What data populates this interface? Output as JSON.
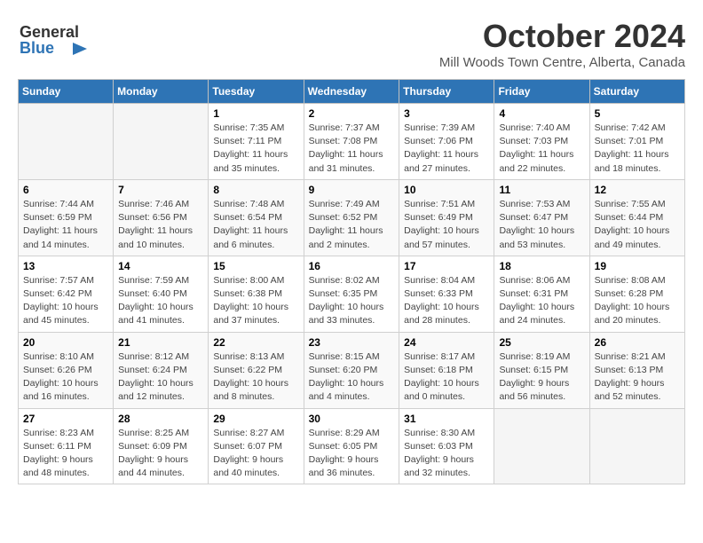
{
  "header": {
    "logo_line1": "General",
    "logo_line2": "Blue",
    "title": "October 2024",
    "subtitle": "Mill Woods Town Centre, Alberta, Canada"
  },
  "calendar": {
    "days_of_week": [
      "Sunday",
      "Monday",
      "Tuesday",
      "Wednesday",
      "Thursday",
      "Friday",
      "Saturday"
    ],
    "weeks": [
      [
        {
          "day": "",
          "detail": ""
        },
        {
          "day": "",
          "detail": ""
        },
        {
          "day": "1",
          "detail": "Sunrise: 7:35 AM\nSunset: 7:11 PM\nDaylight: 11 hours and 35 minutes."
        },
        {
          "day": "2",
          "detail": "Sunrise: 7:37 AM\nSunset: 7:08 PM\nDaylight: 11 hours and 31 minutes."
        },
        {
          "day": "3",
          "detail": "Sunrise: 7:39 AM\nSunset: 7:06 PM\nDaylight: 11 hours and 27 minutes."
        },
        {
          "day": "4",
          "detail": "Sunrise: 7:40 AM\nSunset: 7:03 PM\nDaylight: 11 hours and 22 minutes."
        },
        {
          "day": "5",
          "detail": "Sunrise: 7:42 AM\nSunset: 7:01 PM\nDaylight: 11 hours and 18 minutes."
        }
      ],
      [
        {
          "day": "6",
          "detail": "Sunrise: 7:44 AM\nSunset: 6:59 PM\nDaylight: 11 hours and 14 minutes."
        },
        {
          "day": "7",
          "detail": "Sunrise: 7:46 AM\nSunset: 6:56 PM\nDaylight: 11 hours and 10 minutes."
        },
        {
          "day": "8",
          "detail": "Sunrise: 7:48 AM\nSunset: 6:54 PM\nDaylight: 11 hours and 6 minutes."
        },
        {
          "day": "9",
          "detail": "Sunrise: 7:49 AM\nSunset: 6:52 PM\nDaylight: 11 hours and 2 minutes."
        },
        {
          "day": "10",
          "detail": "Sunrise: 7:51 AM\nSunset: 6:49 PM\nDaylight: 10 hours and 57 minutes."
        },
        {
          "day": "11",
          "detail": "Sunrise: 7:53 AM\nSunset: 6:47 PM\nDaylight: 10 hours and 53 minutes."
        },
        {
          "day": "12",
          "detail": "Sunrise: 7:55 AM\nSunset: 6:44 PM\nDaylight: 10 hours and 49 minutes."
        }
      ],
      [
        {
          "day": "13",
          "detail": "Sunrise: 7:57 AM\nSunset: 6:42 PM\nDaylight: 10 hours and 45 minutes."
        },
        {
          "day": "14",
          "detail": "Sunrise: 7:59 AM\nSunset: 6:40 PM\nDaylight: 10 hours and 41 minutes."
        },
        {
          "day": "15",
          "detail": "Sunrise: 8:00 AM\nSunset: 6:38 PM\nDaylight: 10 hours and 37 minutes."
        },
        {
          "day": "16",
          "detail": "Sunrise: 8:02 AM\nSunset: 6:35 PM\nDaylight: 10 hours and 33 minutes."
        },
        {
          "day": "17",
          "detail": "Sunrise: 8:04 AM\nSunset: 6:33 PM\nDaylight: 10 hours and 28 minutes."
        },
        {
          "day": "18",
          "detail": "Sunrise: 8:06 AM\nSunset: 6:31 PM\nDaylight: 10 hours and 24 minutes."
        },
        {
          "day": "19",
          "detail": "Sunrise: 8:08 AM\nSunset: 6:28 PM\nDaylight: 10 hours and 20 minutes."
        }
      ],
      [
        {
          "day": "20",
          "detail": "Sunrise: 8:10 AM\nSunset: 6:26 PM\nDaylight: 10 hours and 16 minutes."
        },
        {
          "day": "21",
          "detail": "Sunrise: 8:12 AM\nSunset: 6:24 PM\nDaylight: 10 hours and 12 minutes."
        },
        {
          "day": "22",
          "detail": "Sunrise: 8:13 AM\nSunset: 6:22 PM\nDaylight: 10 hours and 8 minutes."
        },
        {
          "day": "23",
          "detail": "Sunrise: 8:15 AM\nSunset: 6:20 PM\nDaylight: 10 hours and 4 minutes."
        },
        {
          "day": "24",
          "detail": "Sunrise: 8:17 AM\nSunset: 6:18 PM\nDaylight: 10 hours and 0 minutes."
        },
        {
          "day": "25",
          "detail": "Sunrise: 8:19 AM\nSunset: 6:15 PM\nDaylight: 9 hours and 56 minutes."
        },
        {
          "day": "26",
          "detail": "Sunrise: 8:21 AM\nSunset: 6:13 PM\nDaylight: 9 hours and 52 minutes."
        }
      ],
      [
        {
          "day": "27",
          "detail": "Sunrise: 8:23 AM\nSunset: 6:11 PM\nDaylight: 9 hours and 48 minutes."
        },
        {
          "day": "28",
          "detail": "Sunrise: 8:25 AM\nSunset: 6:09 PM\nDaylight: 9 hours and 44 minutes."
        },
        {
          "day": "29",
          "detail": "Sunrise: 8:27 AM\nSunset: 6:07 PM\nDaylight: 9 hours and 40 minutes."
        },
        {
          "day": "30",
          "detail": "Sunrise: 8:29 AM\nSunset: 6:05 PM\nDaylight: 9 hours and 36 minutes."
        },
        {
          "day": "31",
          "detail": "Sunrise: 8:30 AM\nSunset: 6:03 PM\nDaylight: 9 hours and 32 minutes."
        },
        {
          "day": "",
          "detail": ""
        },
        {
          "day": "",
          "detail": ""
        }
      ]
    ]
  }
}
